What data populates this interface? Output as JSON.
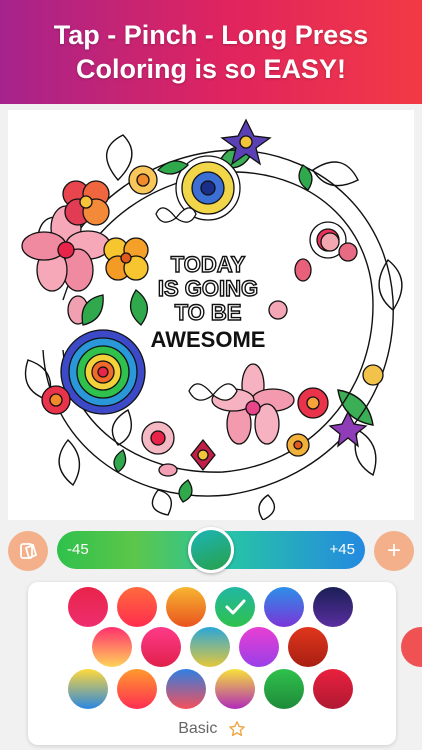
{
  "banner": {
    "line1": "Tap - Pinch - Long Press",
    "line2": "Coloring is so EASY!"
  },
  "artwork": {
    "line1": "TODAY",
    "line2": "IS GOING",
    "line3": "TO BE",
    "line4": "AWESOME"
  },
  "slider": {
    "min_label": "-45",
    "max_label": "+45",
    "value": 0.5,
    "track_colors": [
      "#2fc14c",
      "#27c4a6",
      "#2489e0"
    ]
  },
  "buttons": {
    "palette_picker_icon": "palette-card-icon",
    "add_label": "+"
  },
  "palette": {
    "name": "Basic",
    "favorite_icon": "star-outline-icon",
    "selected_index": 3,
    "swatches": [
      [
        "#e8244a",
        "#ee2d6e"
      ],
      [
        "#ff6a3d",
        "#ff2d4e"
      ],
      [
        "#f7b531",
        "#e9541f"
      ],
      [
        "#21b7a4",
        "#2fc14c"
      ],
      [
        "#2c8fe8",
        "#7b35d8"
      ],
      [
        "#1a1f55",
        "#5a2ea0"
      ],
      [
        "#ff2f6e",
        "#ffd35a"
      ],
      [
        "#ff3a8a",
        "#e0204a"
      ],
      [
        "#2aa6d9",
        "#e4c73a"
      ],
      [
        "#e83fd2",
        "#9a3fe8"
      ],
      [
        "#e0361c",
        "#a81f12"
      ],
      [
        "#ffd93a",
        "#2a86e0"
      ],
      [
        "#ff9a2d",
        "#ff2d52"
      ],
      [
        "#2e7fe2",
        "#f5505a"
      ],
      [
        "#f7e23a",
        "#b02ab8"
      ],
      [
        "#2fc14c",
        "#1f8a3a"
      ],
      [
        "#e9213e",
        "#b01832"
      ]
    ]
  },
  "colors": {
    "banner_left": "#a6238d",
    "banner_right": "#f23a45",
    "accent_button": "#f3b08a",
    "side_tab": "#f05253"
  }
}
